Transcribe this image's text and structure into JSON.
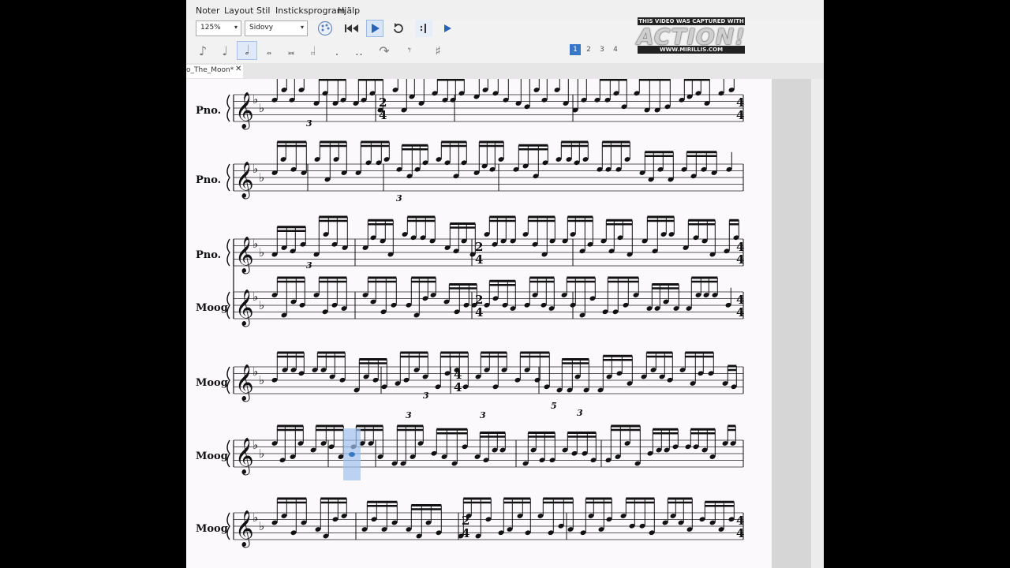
{
  "menu": [
    "Noter",
    "Layout",
    "Stil",
    "Insticksprogram",
    "Hjälp"
  ],
  "toolbar": {
    "zoom": "125%",
    "view": "Sidovy"
  },
  "pages": [
    "1",
    "2",
    "3",
    "4"
  ],
  "tab": {
    "title": "o_The_Moon*",
    "close": "✕"
  },
  "watermark": {
    "line1": "THIS VIDEO WAS CAPTURED WITH",
    "logo": "ACTION!",
    "url": "WWW.MIRILLIS.COM"
  },
  "staves": [
    {
      "label": "Pno.",
      "time": "2/4 · 4/4"
    },
    {
      "label": "Pno.",
      "time": ""
    },
    {
      "label": "Pno.",
      "time": "2/4 · 4/4"
    },
    {
      "label": "Moog",
      "time": "2/4 · 4/4"
    },
    {
      "label": "Moog",
      "time": "4/4"
    },
    {
      "label": "Moog",
      "time": ""
    },
    {
      "label": "Moog",
      "time": "2/4 · 4/4"
    }
  ],
  "tuplets": [
    "3",
    "3",
    "3",
    "3",
    "3",
    "3",
    "3",
    "5"
  ],
  "colors": {
    "accent": "#3777c8",
    "selection": "#9fc2ee",
    "score_bg": "#fbf9fc"
  }
}
